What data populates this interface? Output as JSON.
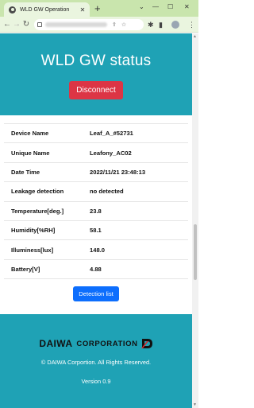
{
  "browser": {
    "tab_title": "WLD GW Operation",
    "close_glyph": "✕",
    "new_tab_glyph": "+",
    "window_controls": [
      "⌄",
      "—",
      "☐",
      "✕"
    ]
  },
  "toolbar": {
    "back": "←",
    "forward": "→",
    "reload": "↻",
    "right_icons": [
      "☆",
      "⋮"
    ]
  },
  "header": {
    "title": "WLD GW status",
    "disconnect_label": "Disconnect"
  },
  "info_rows": [
    {
      "label": "Device Name",
      "value": "Leaf_A_#52731"
    },
    {
      "label": "Unique Name",
      "value": "Leafony_AC02"
    },
    {
      "label": "Date Time",
      "value": "2022/11/21 23:48:13"
    },
    {
      "label": "Leakage detection",
      "value": "no detected"
    },
    {
      "label": "Temperature[deg.]",
      "value": "23.8"
    },
    {
      "label": "Humidity[%RH]",
      "value": "58.1"
    },
    {
      "label": "Illuminess[lux]",
      "value": "148.0"
    },
    {
      "label": "Battery[V]",
      "value": "4.88"
    }
  ],
  "detection_button_label": "Detection list",
  "footer": {
    "logo_daiwa": "DAIWA",
    "logo_corp": "CORPORATION",
    "copyright": "© DAIWA Corportion. All Rights Reserved.",
    "version": "Version 0.9"
  },
  "colors": {
    "brand_teal": "#1fa2b5",
    "danger": "#dc3545",
    "primary": "#0d6efd",
    "logo_red": "#d7282f"
  }
}
